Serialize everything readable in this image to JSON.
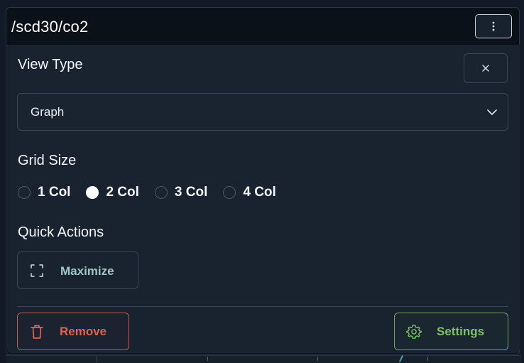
{
  "widget": {
    "title": "/scd30/co2"
  },
  "menu": {
    "view_type": {
      "label": "View Type",
      "selected": "Graph"
    },
    "grid_size": {
      "label": "Grid Size",
      "options": [
        "1 Col",
        "2 Col",
        "3 Col",
        "4 Col"
      ],
      "selected": "2 Col"
    },
    "quick_actions": {
      "label": "Quick Actions",
      "maximize_label": "Maximize"
    },
    "footer": {
      "remove_label": "Remove",
      "settings_label": "Settings"
    }
  },
  "icons": {
    "kebab": "more-vertical-icon",
    "close": "close-icon",
    "chevron": "chevron-down-icon",
    "maximize": "maximize-icon",
    "remove": "trash-icon",
    "settings": "gear-icon"
  },
  "colors": {
    "panel_bg": "#19232f",
    "header_bg": "#0b1119",
    "remove_accent": "#e0634f",
    "settings_accent": "#7fc068",
    "maximize_text": "#9fc7c6"
  }
}
